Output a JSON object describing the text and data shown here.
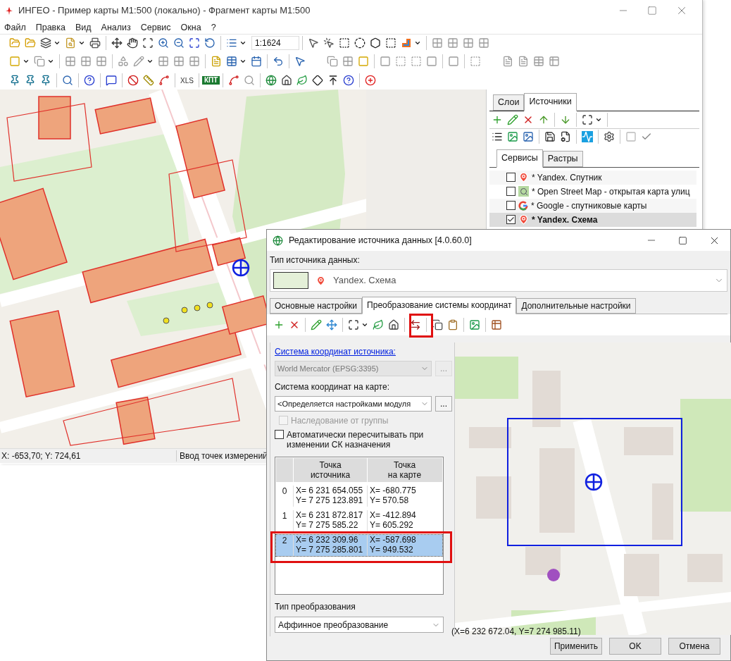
{
  "main_window": {
    "title": "ИНГЕО - Пример карты М1:500 (локально) - Фрагмент карты М1:500"
  },
  "menu": [
    "Файл",
    "Правка",
    "Вид",
    "Анализ",
    "Сервис",
    "Окна",
    "?"
  ],
  "toolbar": {
    "scale": "1:1624",
    "text_buttons": [
      "XLS",
      "КПТ"
    ]
  },
  "side_panel": {
    "tabs": [
      {
        "label": "Слои",
        "selected": false
      },
      {
        "label": "Источники",
        "selected": true
      }
    ],
    "subtabs": [
      {
        "label": "Сервисы",
        "selected": true
      },
      {
        "label": "Растры",
        "selected": false
      }
    ],
    "sources": [
      {
        "label": "* Yandex. Спутник",
        "checked": false,
        "selected": false,
        "kind": "pin"
      },
      {
        "label": "* Open Street Map - открытая карта улиц",
        "checked": false,
        "selected": false,
        "kind": "osm"
      },
      {
        "label": "* Google - спутниковые карты",
        "checked": false,
        "selected": false,
        "kind": "google"
      },
      {
        "label": "* Yandex. Схема",
        "checked": true,
        "selected": true,
        "kind": "pin"
      }
    ]
  },
  "status_bar": {
    "coordinates": "X: -653,70; Y: 724,61",
    "mode": "Ввод точек измерений"
  },
  "dialog": {
    "title": "Редактирование источника данных [4.0.60.0]",
    "source_type_label": "Тип источника данных:",
    "source_type": "Yandex. Схема",
    "tabs": [
      {
        "label": "Основные настройки",
        "selected": false
      },
      {
        "label": "Преобразование системы координат",
        "selected": true
      },
      {
        "label": "Дополнительные настройки",
        "selected": false
      }
    ],
    "source_crs_link": "Система координат источника:",
    "source_crs": {
      "value": "World Mercator (EPSG:3395)",
      "disabled": true,
      "browse": {
        "label": "...",
        "disabled": true
      }
    },
    "map_crs_label": "Система координат на карте:",
    "map_crs": {
      "value": "<Определяется настройками модуля",
      "disabled": false,
      "browse": {
        "label": "...",
        "disabled": false
      }
    },
    "inherit": {
      "label": "Наследование от группы",
      "checked": false,
      "disabled": true
    },
    "auto_recalc": {
      "label": "Автоматически пересчитывать при изменении СК назначения",
      "checked": false,
      "disabled": false
    },
    "points": {
      "columns": [
        "Точка\nисточника",
        "Точка\nна карте"
      ],
      "rows": [
        {
          "index": "0",
          "source": [
            "X= 6 231 654.055",
            "Y= 7 275 123.891"
          ],
          "map": [
            "X= -680.775",
            "Y= 570.58"
          ],
          "selected": false
        },
        {
          "index": "1",
          "source": [
            "X= 6 231 872.817",
            "Y= 7 275 585.22"
          ],
          "map": [
            "X= -412.894",
            "Y= 605.292"
          ],
          "selected": false
        },
        {
          "index": "2",
          "source": [
            "X= 6 232 309.96",
            "Y= 7 275 285.801"
          ],
          "map": [
            "X= -587.698",
            "Y= 949.532"
          ],
          "selected": true
        }
      ]
    },
    "transform_label": "Тип преобразования",
    "transform": "Аффинное преобразование",
    "cursor_coordinates": "(X=6 232 672.04, Y=7 274 985.11)",
    "buttons": [
      "Применить",
      "OK",
      "Отмена"
    ]
  }
}
